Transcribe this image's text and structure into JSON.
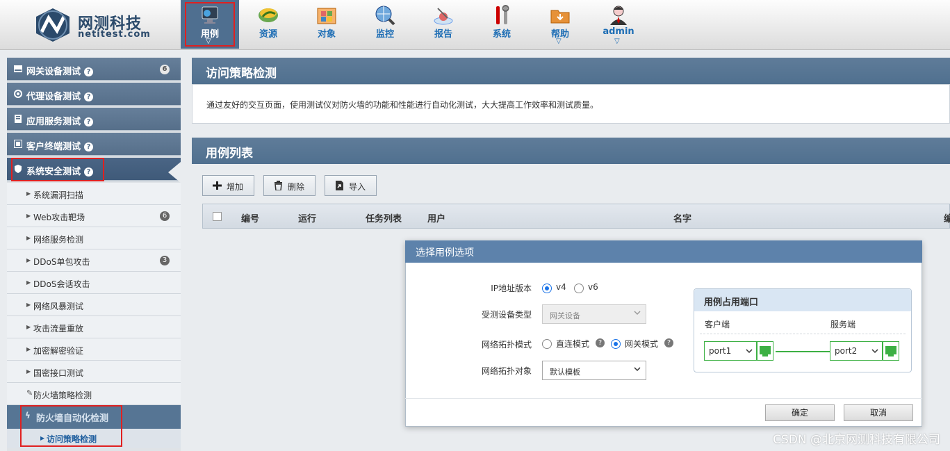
{
  "brand": {
    "name_cn": "网测科技",
    "name_en": "netitest.com"
  },
  "nav": [
    {
      "label": "用例",
      "icon": "monitor-icon",
      "active": true,
      "caret": true
    },
    {
      "label": "资源",
      "icon": "resource-icon",
      "active": false,
      "caret": false
    },
    {
      "label": "对象",
      "icon": "object-icon",
      "active": false,
      "caret": false
    },
    {
      "label": "监控",
      "icon": "monitor-globe-icon",
      "active": false,
      "caret": false
    },
    {
      "label": "报告",
      "icon": "report-icon",
      "active": false,
      "caret": false
    },
    {
      "label": "系统",
      "icon": "tools-icon",
      "active": false,
      "caret": false
    },
    {
      "label": "帮助",
      "icon": "help-folder-icon",
      "active": false,
      "caret": true
    },
    {
      "label": "admin",
      "icon": "user-icon",
      "active": false,
      "caret": true
    }
  ],
  "sidebar": {
    "groups": [
      {
        "label": "网关设备测试",
        "icon": "gateway-icon",
        "badge": "6"
      },
      {
        "label": "代理设备测试",
        "icon": "proxy-icon",
        "badge": ""
      },
      {
        "label": "应用服务测试",
        "icon": "app-server-icon",
        "badge": ""
      },
      {
        "label": "客户终端测试",
        "icon": "client-icon",
        "badge": ""
      },
      {
        "label": "系统安全测试",
        "icon": "shield-icon",
        "badge": ""
      }
    ],
    "subitems": [
      {
        "label": "系统漏洞扫描",
        "badge": ""
      },
      {
        "label": "Web攻击靶场",
        "badge": "6"
      },
      {
        "label": "网络服务检测",
        "badge": ""
      },
      {
        "label": "DDoS单包攻击",
        "badge": "3"
      },
      {
        "label": "DDoS会话攻击",
        "badge": ""
      },
      {
        "label": "网络风暴测试",
        "badge": ""
      },
      {
        "label": "攻击流量重放",
        "badge": ""
      },
      {
        "label": "加密解密验证",
        "badge": ""
      },
      {
        "label": "国密接口测试",
        "badge": ""
      },
      {
        "label": "防火墙策略检测",
        "badge": ""
      }
    ],
    "active_sub": "防火墙自动化检测",
    "active_leaf": "访问策略检测"
  },
  "main": {
    "title": "访问策略检测",
    "description": "通过友好的交互页面，使用测试仪对防火墙的功能和性能进行自动化测试，大大提高工作效率和测试质量。",
    "list_title": "用例列表",
    "buttons": {
      "add": "增加",
      "delete": "删除",
      "import": "导入"
    },
    "columns": [
      "编号",
      "运行",
      "任务列表",
      "用户",
      "名字",
      "编"
    ]
  },
  "dialog": {
    "title": "选择用例选项",
    "ip_label": "IP地址版本",
    "ip_options": [
      "v4",
      "v6"
    ],
    "ip_selected": "v4",
    "device_label": "受测设备类型",
    "device_value": "网关设备",
    "topo_mode_label": "网络拓扑模式",
    "topo_modes": [
      "直连模式",
      "网关模式"
    ],
    "topo_mode_selected": "网关模式",
    "topo_obj_label": "网络拓扑对象",
    "topo_obj_value": "默认模板",
    "ports": {
      "title": "用例占用端口",
      "client_label": "客户端",
      "server_label": "服务端",
      "client_port": "port1",
      "server_port": "port2"
    },
    "ok": "确定",
    "cancel": "取消"
  },
  "watermark": "CSDN @北京网测科技有限公司",
  "colors": {
    "accent": "#1a73e8",
    "nav_active": "#4f6f90",
    "highlight": "#e02020",
    "port_green": "#3cb043"
  }
}
